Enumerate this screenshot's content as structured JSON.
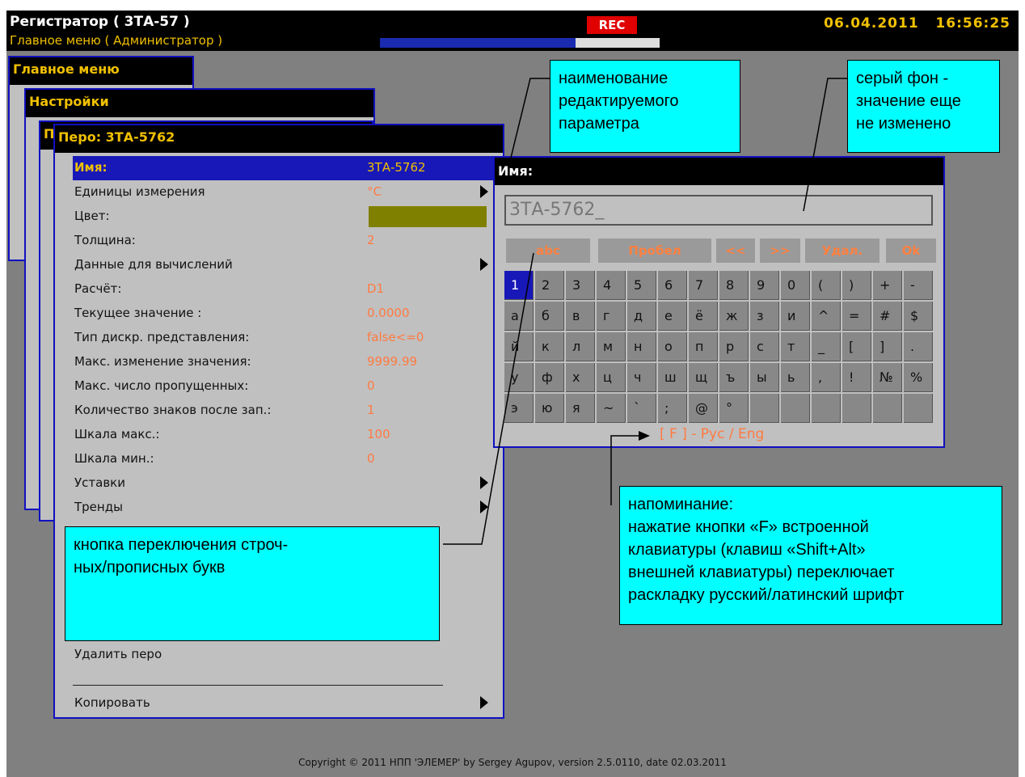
{
  "header": {
    "title": "Регистратор ( 3ТА-57 )",
    "subtitle": "Главное меню ( Администратор )",
    "rec_label": "REC",
    "date": "06.04.2011",
    "time": "16:56:25",
    "progress_fraction": 0.7,
    "colors": {
      "accent": "#f0c000",
      "rec": "#e00000",
      "frame": "#1010c0",
      "callout": "#00ffff"
    }
  },
  "windows": {
    "main_menu_title": "Главное меню",
    "settings_title": "Настройки",
    "third_title_letter": "П",
    "pen_title": "Перо: 3ТА-5762"
  },
  "menu": {
    "rows": [
      {
        "label": "Имя:",
        "value": "3ТА-5762"
      },
      {
        "label": "Единицы измерения",
        "value": "°C"
      },
      {
        "label": "Цвет:",
        "value": ""
      },
      {
        "label": "Толщина:",
        "value": "2"
      },
      {
        "label": "Данные для вычислений",
        "value": ""
      },
      {
        "label": "Расчёт:",
        "value": "D1"
      },
      {
        "label": "Текущее значение :",
        "value": "0.0000"
      },
      {
        "label": "Тип дискр. представления:",
        "value": "false<=0"
      },
      {
        "label": "Макс. изменение значения:",
        "value": "9999.99"
      },
      {
        "label": "Макс. число пропущенных:",
        "value": "0"
      },
      {
        "label": "Количество знаков после зап.:",
        "value": "1"
      },
      {
        "label": "Шкала макс.:",
        "value": "100"
      },
      {
        "label": "Шкала мин.:",
        "value": "0"
      },
      {
        "label": "Уставки",
        "value": ""
      },
      {
        "label": "Тренды",
        "value": ""
      }
    ],
    "delete_pen": "Удалить перо",
    "copy": "Копировать",
    "color_swatch": "#808000"
  },
  "keyboard": {
    "title": "Имя:",
    "input_value": "3ТА-5762_",
    "buttons": {
      "case": "abc",
      "space": "Пробел",
      "left": "<<",
      "right": ">>",
      "delete": "Удал.",
      "ok": "Ok"
    },
    "rows": [
      [
        "1",
        "2",
        "3",
        "4",
        "5",
        "6",
        "7",
        "8",
        "9",
        "0",
        "(",
        ")",
        "+",
        "-"
      ],
      [
        "а",
        "б",
        "в",
        "г",
        "д",
        "е",
        "ё",
        "ж",
        "з",
        "и",
        "^",
        "=",
        "#",
        "$"
      ],
      [
        "й",
        "к",
        "л",
        "м",
        "н",
        "о",
        "п",
        "р",
        "с",
        "т",
        "_",
        "[",
        "]",
        "."
      ],
      [
        "у",
        "ф",
        "х",
        "ц",
        "ч",
        "ш",
        "щ",
        "ъ",
        "ы",
        "ь",
        ",",
        "!",
        "№",
        "%"
      ],
      [
        "э",
        "ю",
        "я",
        "~",
        "`",
        ";",
        "@",
        "°",
        "",
        "",
        "",
        "",
        "",
        ""
      ]
    ],
    "hint": "[ F ] - Рус / Eng"
  },
  "callouts": {
    "name_param": [
      "наименование",
      "редактируемого",
      "параметра"
    ],
    "grey_bg": [
      "серый фон -",
      "значение еще",
      "не изменено"
    ],
    "case_button": [
      "кнопка переключения строч-",
      "ных/прописных букв"
    ],
    "reminder": [
      "напоминание:",
      "нажатие кнопки «F» встроенной",
      "клавиатуры (клавиш «Shift+Alt»",
      "внешней клавиатуры) переключает",
      "раскладку русский/латинский шрифт"
    ]
  },
  "copyright": "Copyright © 2011 НПП 'ЭЛЕМЕР' by Sergey Agupov, version 2.5.0110, date 02.03.2011"
}
